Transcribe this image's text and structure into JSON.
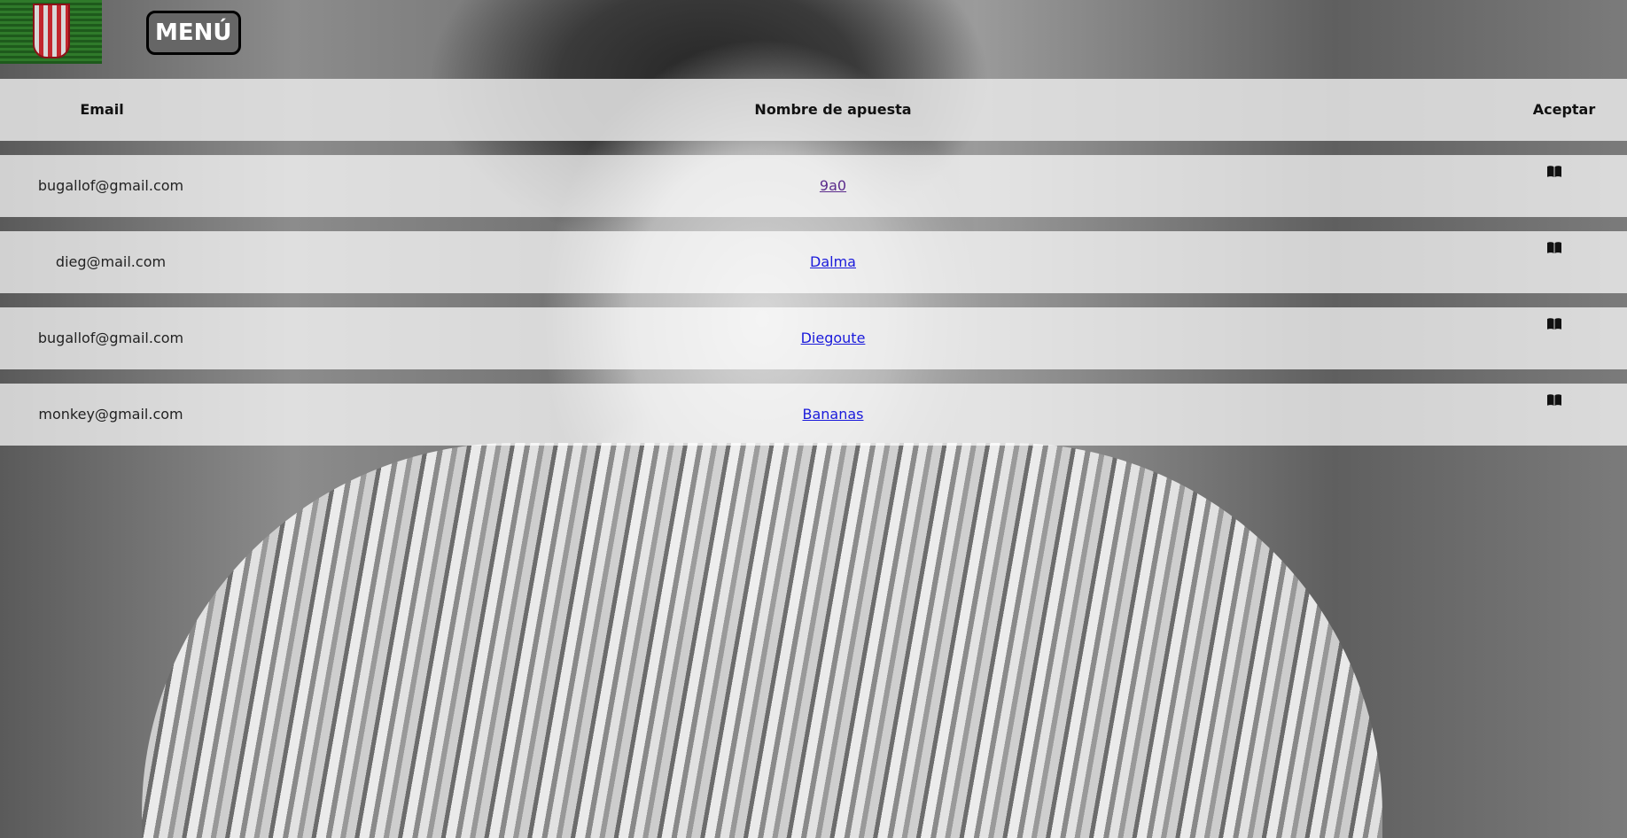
{
  "header": {
    "menu_label": "MENÚ"
  },
  "table": {
    "columns": {
      "email": "Email",
      "bet_name": "Nombre de apuesta",
      "accept": "Aceptar"
    },
    "rows": [
      {
        "email": "bugallof@gmail.com",
        "bet_name": "9a0",
        "accept_icon": "book-icon"
      },
      {
        "email": "dieg@mail.com",
        "bet_name": "Dalma",
        "accept_icon": "book-icon"
      },
      {
        "email": "bugallof@gmail.com",
        "bet_name": "Diegoute",
        "accept_icon": "book-icon"
      },
      {
        "email": "monkey@gmail.com",
        "bet_name": "Bananas",
        "accept_icon": "book-icon"
      }
    ]
  },
  "colors": {
    "link": "#1a1adb",
    "visited_link": "#5b2b8c",
    "menu_bg": "#666666"
  }
}
